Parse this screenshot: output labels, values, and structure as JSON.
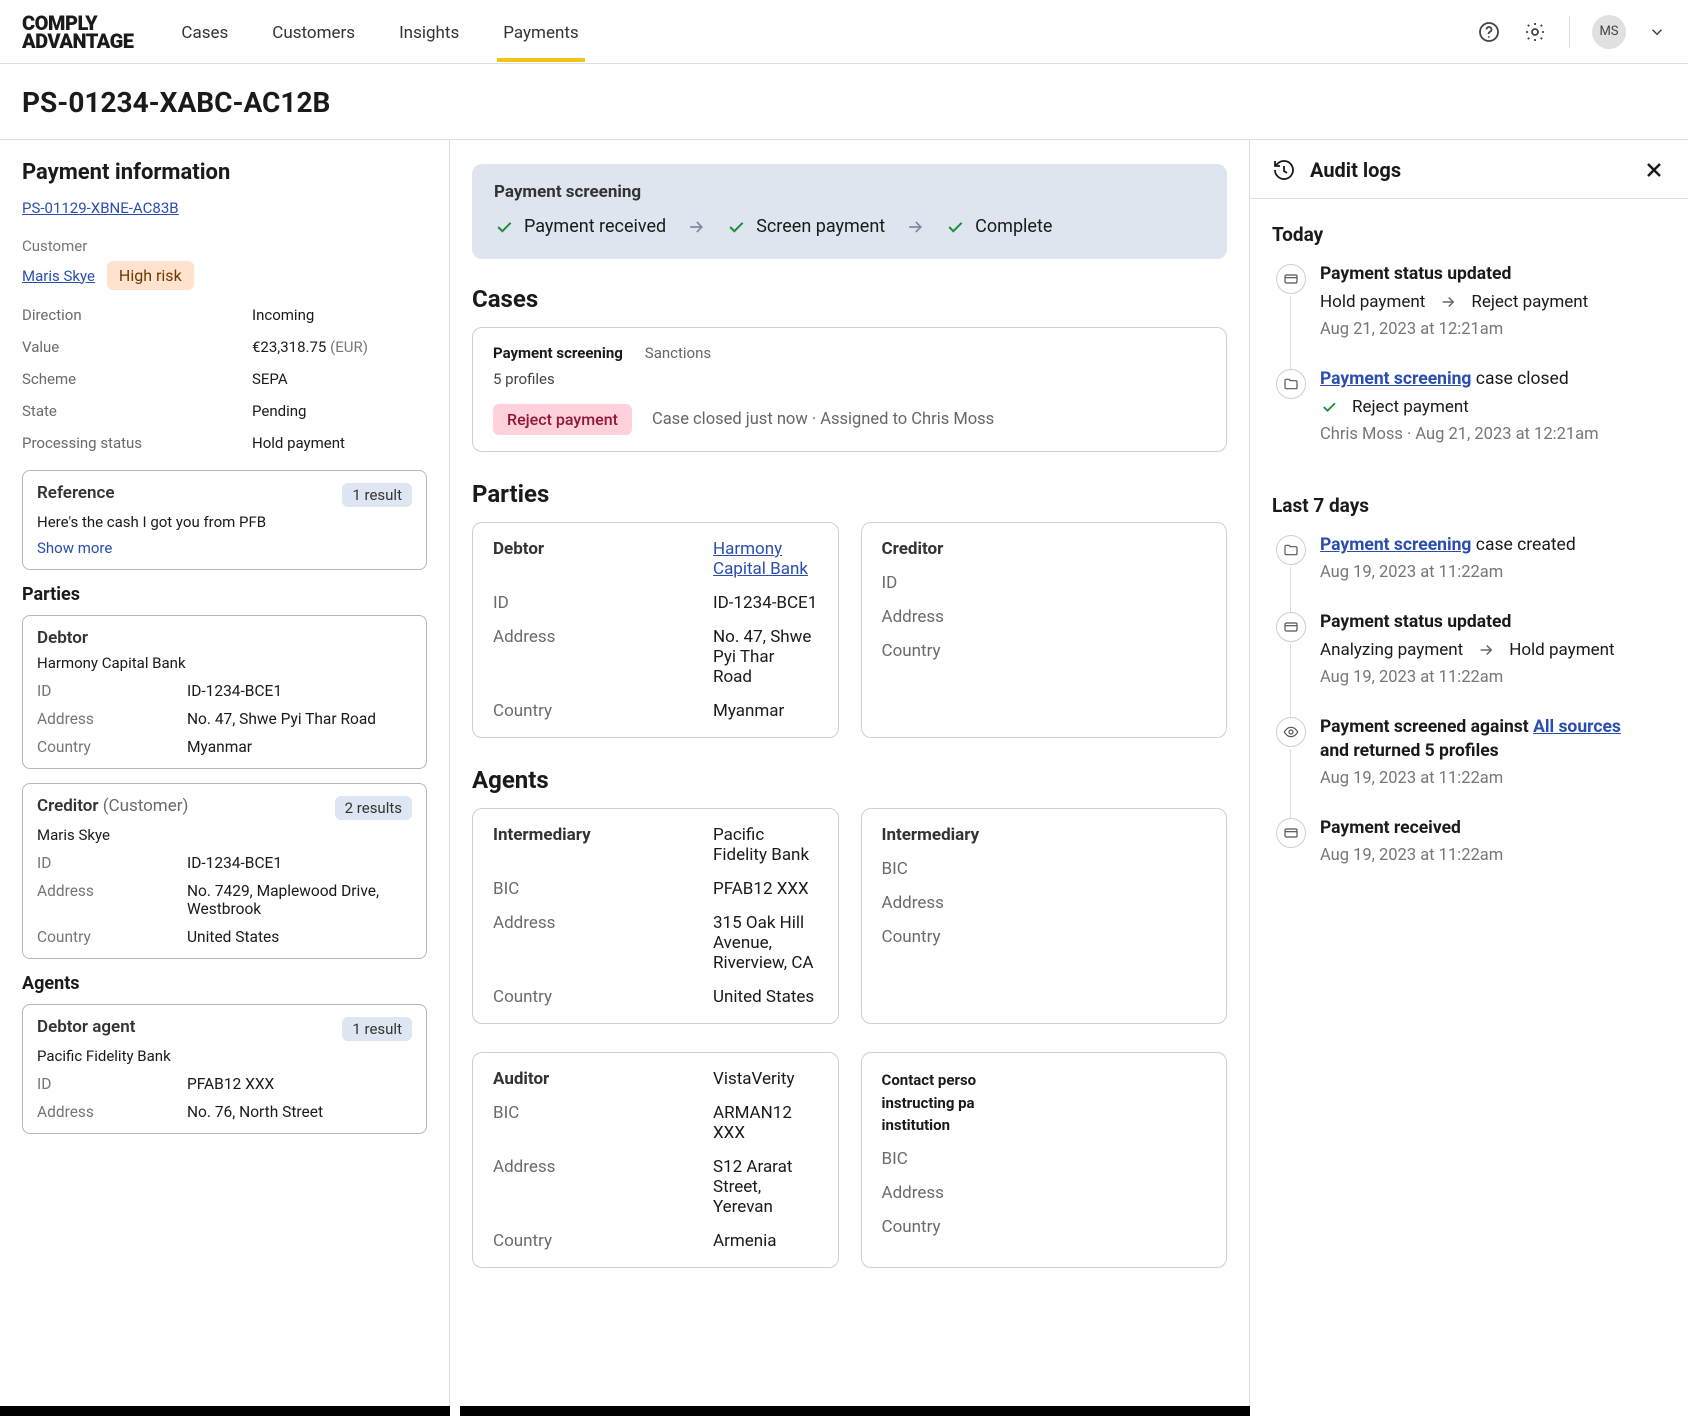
{
  "brand": {
    "line1": "COMPLY",
    "line2": "ADVANTAGE"
  },
  "nav": {
    "tabs": [
      "Cases",
      "Customers",
      "Insights",
      "Payments"
    ],
    "active": 3,
    "avatar_initials": "MS"
  },
  "page": {
    "title": "PS-01234-XABC-AC12B"
  },
  "left": {
    "heading": "Payment information",
    "related_id": "PS-01129-XBNE-AC83B",
    "customer_label": "Customer",
    "customer_name": "Maris Skye",
    "customer_risk": "High risk",
    "kv": {
      "direction_k": "Direction",
      "direction_v": "Incoming",
      "value_k": "Value",
      "value_v": "€23,318.75",
      "value_ccy": "(EUR)",
      "scheme_k": "Scheme",
      "scheme_v": "SEPA",
      "state_k": "State",
      "state_v": "Pending",
      "proc_k": "Processing status",
      "proc_v": "Hold payment"
    },
    "reference": {
      "title": "Reference",
      "count": "1 result",
      "text": "Here's the cash I got you from PFB",
      "more": "Show more"
    },
    "parties_heading": "Parties",
    "debtor": {
      "title": "Debtor",
      "name": "Harmony Capital Bank",
      "id_k": "ID",
      "id_v": "ID-1234-BCE1",
      "addr_k": "Address",
      "addr_v": "No. 47, Shwe Pyi Thar Road",
      "country_k": "Country",
      "country_v": "Myanmar"
    },
    "creditor": {
      "title": "Creditor",
      "sub": "(Customer)",
      "count": "2 results",
      "name": "Maris Skye",
      "id_k": "ID",
      "id_v": "ID-1234-BCE1",
      "addr_k": "Address",
      "addr_v": "No. 7429, Maplewood Drive, Westbrook",
      "country_k": "Country",
      "country_v": "United States"
    },
    "agents_heading": "Agents",
    "debtor_agent": {
      "title": "Debtor agent",
      "count": "1 result",
      "name": "Pacific Fidelity Bank",
      "id_k": "ID",
      "id_v": "PFAB12 XXX",
      "addr_k": "Address",
      "addr_v": "No. 76, North Street"
    }
  },
  "mid": {
    "banner_title": "Payment screening",
    "steps": [
      "Payment received",
      "Screen payment",
      "Complete"
    ],
    "cases_heading": "Cases",
    "case": {
      "title": "Payment screening",
      "type": "Sanctions",
      "profiles": "5 profiles",
      "outcome": "Reject payment",
      "meta": "Case closed just now · Assigned to Chris Moss"
    },
    "parties_heading": "Parties",
    "party_debtor": {
      "role": "Debtor",
      "name": "Harmony Capital Bank",
      "id_k": "ID",
      "id_v": "ID-1234-BCE1",
      "addr_k": "Address",
      "addr_v": "No. 47, Shwe Pyi Thar Road",
      "country_k": "Country",
      "country_v": "Myanmar"
    },
    "party_creditor": {
      "role": "Creditor",
      "id_k": "ID",
      "addr_k": "Address",
      "country_k": "Country"
    },
    "agents_heading": "Agents",
    "agent_intermediary": {
      "role": "Intermediary",
      "name": "Pacific Fidelity Bank",
      "bic_k": "BIC",
      "bic_v": "PFAB12 XXX",
      "addr_k": "Address",
      "addr_v": "315 Oak Hill Avenue, Riverview, CA",
      "country_k": "Country",
      "country_v": "United States"
    },
    "agent_intermediary_right": {
      "role": "Intermediary",
      "bic_k": "BIC",
      "addr_k": "Address",
      "country_k": "Country"
    },
    "agent_auditor": {
      "role": "Auditor",
      "name": "VistaVerity",
      "bic_k": "BIC",
      "bic_v": "ARMAN12 XXX",
      "addr_k": "Address",
      "addr_v": "S12 Ararat Street, Yerevan",
      "country_k": "Country",
      "country_v": "Armenia"
    },
    "agent_contact": {
      "role_l1": "Contact perso",
      "role_l2": "instructing pa",
      "role_l3": "institution",
      "bic_k": "BIC",
      "addr_k": "Address",
      "country_k": "Country"
    }
  },
  "right": {
    "heading": "Audit logs",
    "today_label": "Today",
    "last7_label": "Last 7 days",
    "items": [
      {
        "title_bold": "Payment status updated",
        "row_from": "Hold payment",
        "row_to": "Reject payment",
        "ts": "Aug 21, 2023 at 12:21am"
      },
      {
        "link": "Payment screening",
        "suffix": " case closed",
        "row_text": "Reject payment",
        "meta": "Chris Moss · Aug 21, 2023 at 12:21am"
      },
      {
        "link": "Payment screening",
        "suffix": " case created",
        "ts": "Aug 19, 2023 at 11:22am"
      },
      {
        "title_bold": "Payment status updated",
        "row_from": "Analyzing payment",
        "row_to": "Hold payment",
        "ts": "Aug 19, 2023 at 11:22am"
      },
      {
        "prefix": "Payment screened against ",
        "link": "All sources",
        "suffix2": "and returned 5 profiles",
        "ts": "Aug 19, 2023 at 11:22am"
      },
      {
        "title_bold": "Payment received",
        "ts": "Aug 19, 2023 at 11:22am"
      }
    ]
  }
}
